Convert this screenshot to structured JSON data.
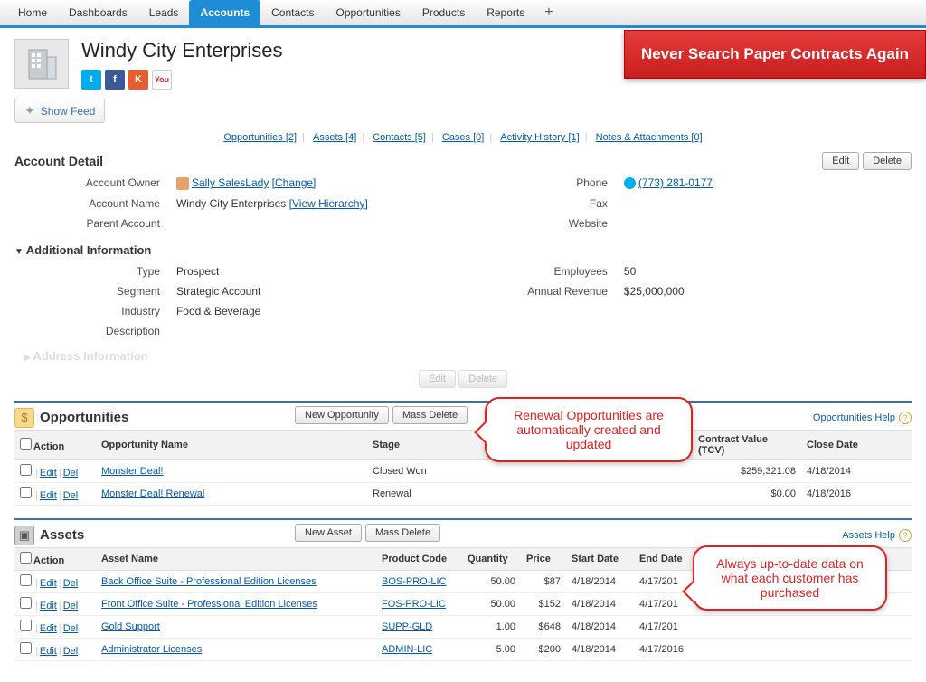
{
  "nav": {
    "tabs": [
      "Home",
      "Dashboards",
      "Leads",
      "Accounts",
      "Contacts",
      "Opportunities",
      "Products",
      "Reports"
    ],
    "active": "Accounts",
    "plus": "+"
  },
  "header": {
    "title": "Windy City Enterprises",
    "banner": "Never Search Paper Contracts Again",
    "show_feed": "Show Feed"
  },
  "subnav": {
    "items": [
      {
        "label": "Opportunities",
        "count": "[2]"
      },
      {
        "label": "Assets",
        "count": "[4]"
      },
      {
        "label": "Contacts",
        "count": "[5]"
      },
      {
        "label": "Cases",
        "count": "[0]"
      },
      {
        "label": "Activity History",
        "count": "[1]"
      },
      {
        "label": "Notes & Attachments",
        "count": "[0]"
      }
    ]
  },
  "detail": {
    "title": "Account Detail",
    "edit": "Edit",
    "delete": "Delete",
    "owner_label": "Account Owner",
    "owner_val": "Sally SalesLady",
    "owner_change": "[Change]",
    "name_label": "Account Name",
    "name_val": "Windy City Enterprises",
    "view_hier": "[View Hierarchy]",
    "parent_label": "Parent Account",
    "parent_val": "",
    "phone_label": "Phone",
    "phone_val": "(773) 281-0177",
    "fax_label": "Fax",
    "fax_val": "",
    "website_label": "Website",
    "website_val": ""
  },
  "addl": {
    "title": "Additional Information",
    "type_label": "Type",
    "type_val": "Prospect",
    "segment_label": "Segment",
    "segment_val": "Strategic Account",
    "industry_label": "Industry",
    "industry_val": "Food & Beverage",
    "desc_label": "Description",
    "desc_val": "",
    "employees_label": "Employees",
    "employees_val": "50",
    "revenue_label": "Annual Revenue",
    "revenue_val": "$25,000,000"
  },
  "addr_ghost": "Address Information",
  "opps": {
    "title": "Opportunities",
    "new_btn": "New Opportunity",
    "mass_btn": "Mass Delete",
    "help": "Opportunities Help",
    "cols": {
      "action": "Action",
      "name": "Opportunity Name",
      "stage": "Stage",
      "tcv": "Contract Value (TCV)",
      "close": "Close Date"
    },
    "edit": "Edit",
    "del": "Del",
    "rows": [
      {
        "name": "Monster Deal!",
        "stage": "Closed Won",
        "tcv": "$259,321.08",
        "close": "4/18/2014"
      },
      {
        "name": "Monster Deal! Renewal",
        "stage": "Renewal",
        "tcv": "$0.00",
        "close": "4/18/2016"
      }
    ]
  },
  "assets": {
    "title": "Assets",
    "new_btn": "New Asset",
    "mass_btn": "Mass Delete",
    "help": "Assets Help",
    "cols": {
      "action": "Action",
      "name": "Asset Name",
      "code": "Product Code",
      "qty": "Quantity",
      "price": "Price",
      "start": "Start Date",
      "end": "End Date"
    },
    "edit": "Edit",
    "del": "Del",
    "rows": [
      {
        "name": "Back Office Suite - Professional Edition Licenses",
        "code": "BOS-PRO-LIC",
        "qty": "50.00",
        "price": "$87",
        "start": "4/18/2014",
        "end": "4/17/201"
      },
      {
        "name": "Front Office Suite - Professional Edition Licenses",
        "code": "FOS-PRO-LIC",
        "qty": "50.00",
        "price": "$152",
        "start": "4/18/2014",
        "end": "4/17/201"
      },
      {
        "name": "Gold Support",
        "code": "SUPP-GLD",
        "qty": "1.00",
        "price": "$648",
        "start": "4/18/2014",
        "end": "4/17/201"
      },
      {
        "name": "Administrator Licenses",
        "code": "ADMIN-LIC",
        "qty": "5.00",
        "price": "$200",
        "start": "4/18/2014",
        "end": "4/17/2016"
      }
    ]
  },
  "callouts": {
    "c1": "Renewal Opportunities are automatically created and updated",
    "c2": "Always up-to-date data on what each customer has purchased"
  }
}
